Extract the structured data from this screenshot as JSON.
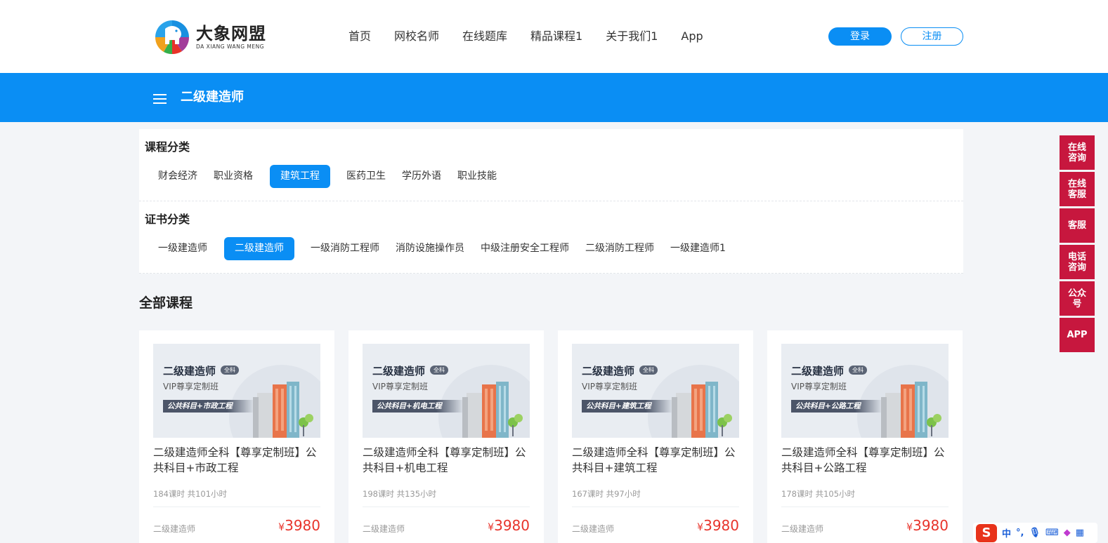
{
  "header": {
    "logo_cn": "大象网盟",
    "logo_en": "DA XIANG WANG MENG",
    "nav": [
      "首页",
      "网校名师",
      "在线题库",
      "精品课程1",
      "关于我们1",
      "App"
    ],
    "login": "登录",
    "register": "注册"
  },
  "bluebar": {
    "title": "二级建造师"
  },
  "filters": {
    "course": {
      "label": "课程分类",
      "items": [
        "财会经济",
        "职业资格",
        "建筑工程",
        "医药卫生",
        "学历外语",
        "职业技能"
      ],
      "active": "建筑工程"
    },
    "cert": {
      "label": "证书分类",
      "items": [
        "一级建造师",
        "二级建造师",
        "一级消防工程师",
        "消防设施操作员",
        "中级注册安全工程师",
        "二级消防工程师",
        "一级建造师1"
      ],
      "active": "二级建造师"
    }
  },
  "section_title": "全部课程",
  "cards": [
    {
      "thumb_title": "二级建造师",
      "thumb_tag": "全科",
      "thumb_sub": "VIP尊享定制班",
      "thumb_ribbon": "公共科目+市政工程",
      "title": "二级建造师全科【尊享定制班】公共科目+市政工程",
      "meta": "184课时 共101小时",
      "category": "二级建造师",
      "price_symbol": "¥",
      "price": "3980"
    },
    {
      "thumb_title": "二级建造师",
      "thumb_tag": "全科",
      "thumb_sub": "VIP尊享定制班",
      "thumb_ribbon": "公共科目+机电工程",
      "title": "二级建造师全科【尊享定制班】公共科目+机电工程",
      "meta": "198课时 共135小时",
      "category": "二级建造师",
      "price_symbol": "¥",
      "price": "3980"
    },
    {
      "thumb_title": "二级建造师",
      "thumb_tag": "全科",
      "thumb_sub": "VIP尊享定制班",
      "thumb_ribbon": "公共科目+建筑工程",
      "title": "二级建造师全科【尊享定制班】公共科目+建筑工程",
      "meta": "167课时 共97小时",
      "category": "二级建造师",
      "price_symbol": "¥",
      "price": "3980"
    },
    {
      "thumb_title": "二级建造师",
      "thumb_tag": "全科",
      "thumb_sub": "VIP尊享定制班",
      "thumb_ribbon": "公共科目+公路工程",
      "title": "二级建造师全科【尊享定制班】公共科目+公路工程",
      "meta": "178课时 共105小时",
      "category": "二级建造师",
      "price_symbol": "¥",
      "price": "3980"
    }
  ],
  "sidebar": [
    "在线咨询",
    "在线客服",
    "客服",
    "电话咨询",
    "公众号",
    "APP"
  ],
  "ime": {
    "logo": "S",
    "lang": "中"
  },
  "colors": {
    "primary": "#0a8ef4",
    "sidebar": "#c7173e",
    "price": "#e8332a"
  }
}
